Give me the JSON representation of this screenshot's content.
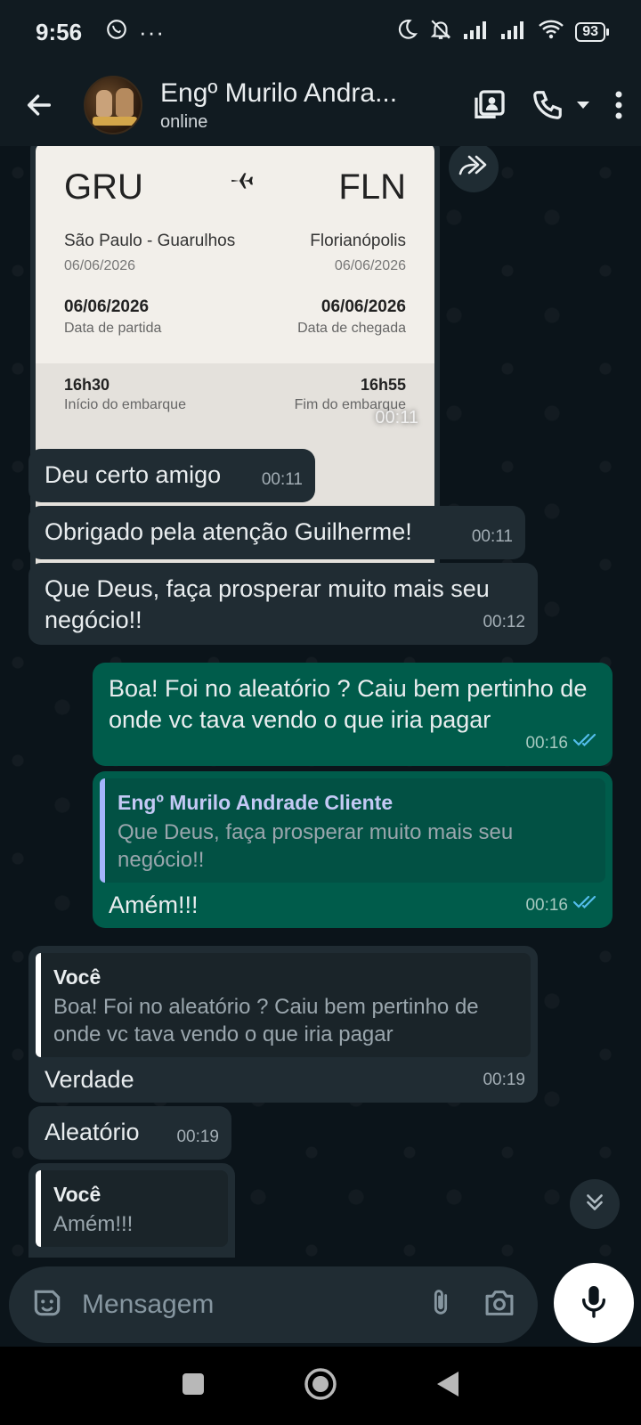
{
  "status_bar": {
    "time": "9:56",
    "battery": "93"
  },
  "header": {
    "contact_name": "Engº Murilo Andra...",
    "status": "online"
  },
  "flight": {
    "from_code": "GRU",
    "to_code": "FLN",
    "from_city": "São Paulo - Guarulhos",
    "to_city": "Florianópolis",
    "from_date": "06/06/2026",
    "to_date": "06/06/2026",
    "departure_date": "06/06/2026",
    "departure_label": "Data de partida",
    "arrival_date": "06/06/2026",
    "arrival_label": "Data de chegada",
    "boarding_start": "16h30",
    "boarding_start_label": "Início do embarque",
    "boarding_end": "16h55",
    "boarding_end_label": "Fim do embarque",
    "time": "00:11"
  },
  "messages": [
    {
      "text": "Deu certo amigo",
      "time": "00:11"
    },
    {
      "text": "Obrigado pela atenção Guilherme!",
      "time": "00:11"
    },
    {
      "text": "Que Deus, faça prosperar muito mais seu negócio!!",
      "time": "00:12"
    },
    {
      "text": "Boa! Foi no aleatório ? Caiu bem pertinho de onde vc tava vendo o que iria pagar",
      "time": "00:16"
    },
    {
      "quote_name": "Engº Murilo Andrade Cliente",
      "quote_text": "Que Deus, faça prosperar muito mais seu negócio!!",
      "text": "Amém!!!",
      "time": "00:16"
    },
    {
      "quote_name": "Você",
      "quote_text": "Boa! Foi no aleatório ? Caiu bem pertinho de onde vc tava vendo o que iria pagar",
      "text": "Verdade",
      "time": "00:19"
    },
    {
      "text": "Aleatório",
      "time": "00:19"
    },
    {
      "quote_name": "Você",
      "quote_text": "Amém!!!"
    }
  ],
  "input": {
    "placeholder": "Mensagem"
  },
  "colors": {
    "incoming": "#202c33",
    "outgoing": "#005c4b",
    "read_ticks": "#53bdeb",
    "background": "#0b141a"
  }
}
